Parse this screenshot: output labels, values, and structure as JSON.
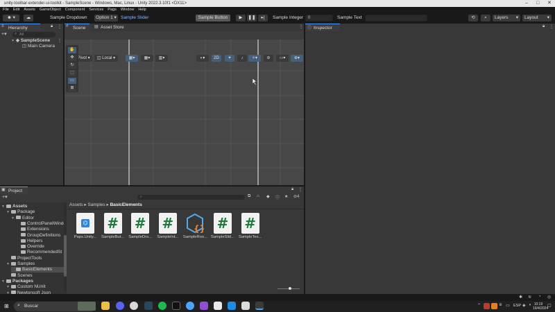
{
  "window": {
    "title": "unity-toolbar-extender-ui-toolkit - SampleScene - Windows, Mac, Linux - Unity 2022.3.10f1 <DX11>"
  },
  "menu": [
    "File",
    "Edit",
    "Assets",
    "GameObject",
    "Component",
    "Services",
    "Pags",
    "Window",
    "Help"
  ],
  "toolbar": {
    "dropdown_label": "Sample Dropdown",
    "option_label": "Option 1",
    "slider_label": "Sample Slider",
    "slider_value": 0.0,
    "button_label": "Sample Button",
    "integer_label": "Sample Integer",
    "integer_value": "0",
    "text_label": "Sample Text",
    "text_value": "",
    "layers_label": "Layers",
    "layout_label": "Layout"
  },
  "hierarchy": {
    "tab": "Hierarchy",
    "search_placeholder": "All",
    "scene": "SampleScene",
    "objects": [
      "Main Camera"
    ]
  },
  "scene_view": {
    "tabs": [
      "Scene",
      "Asset Store"
    ],
    "pivot_label": "Pivot",
    "local_label": "Local",
    "mode_2d": "2D"
  },
  "inspector": {
    "tab": "Inspector"
  },
  "project": {
    "tab": "Project",
    "badge_count": "4",
    "breadcrumb": [
      "Assets",
      "Samples",
      "BasicElements"
    ],
    "tree": [
      {
        "label": "Assets",
        "indent": 0,
        "bold": true
      },
      {
        "label": "Package",
        "indent": 1
      },
      {
        "label": "Editor",
        "indent": 2
      },
      {
        "label": "ControlPanelWindow",
        "indent": 3
      },
      {
        "label": "Extensions",
        "indent": 3
      },
      {
        "label": "GroupDefinitions",
        "indent": 3
      },
      {
        "label": "Helpers",
        "indent": 3
      },
      {
        "label": "Override",
        "indent": 3
      },
      {
        "label": "RecommendedSt",
        "indent": 3
      },
      {
        "label": "ProjectTools",
        "indent": 1
      },
      {
        "label": "Samples",
        "indent": 1
      },
      {
        "label": "BasicElements",
        "indent": 2,
        "selected": true
      },
      {
        "label": "Scenes",
        "indent": 1
      },
      {
        "label": "Packages",
        "indent": 0,
        "bold": true
      },
      {
        "label": "Custom NUnit",
        "indent": 1
      },
      {
        "label": "Newtonsoft Json",
        "indent": 1
      }
    ],
    "assets": [
      {
        "label": "Paps.Unity...",
        "kind": "asmdef"
      },
      {
        "label": "SampleBut...",
        "kind": "script"
      },
      {
        "label": "SampleDro...",
        "kind": "script"
      },
      {
        "label": "SampleInt...",
        "kind": "script"
      },
      {
        "label": "SampleRoo...",
        "kind": "json"
      },
      {
        "label": "SampleSlid...",
        "kind": "script"
      },
      {
        "label": "SampleTex...",
        "kind": "script"
      }
    ]
  },
  "taskbar": {
    "search_placeholder": "Buscar",
    "lang": "ESP",
    "time": "10:19",
    "date": "19/4/2024"
  },
  "colors": {
    "accent": "#4d9cff",
    "panel": "#383838",
    "scene_bg": "#444444",
    "script_green": "#1e7a37"
  }
}
